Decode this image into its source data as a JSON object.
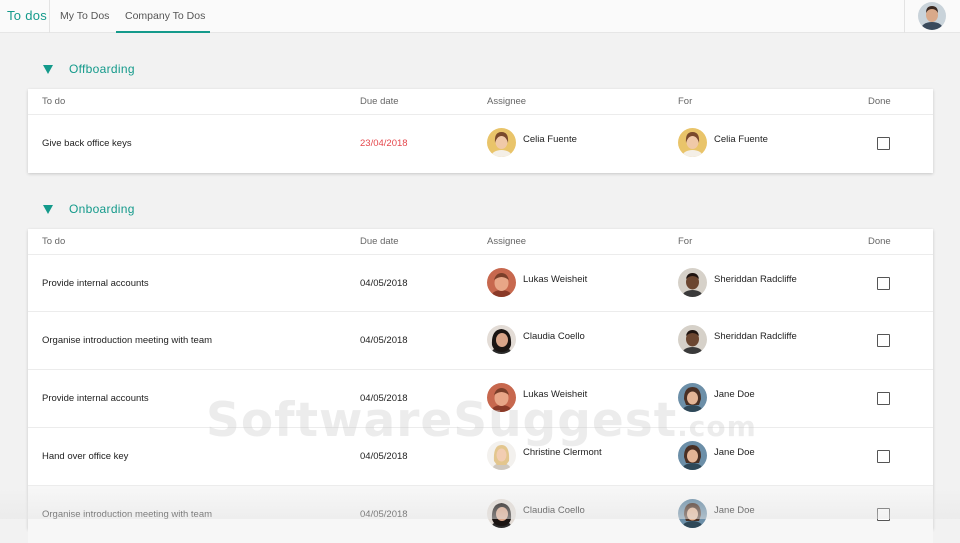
{
  "app": {
    "title": "To dos",
    "tabs": [
      {
        "label": "My To Dos",
        "active": false
      },
      {
        "label": "Company To Dos",
        "active": true
      }
    ],
    "accent_color": "#149a8b"
  },
  "columns": {
    "todo": "To do",
    "due": "Due date",
    "assignee": "Assignee",
    "for": "For",
    "done": "Done"
  },
  "sections": [
    {
      "title": "Offboarding",
      "rows": [
        {
          "todo": "Give back office keys",
          "due": "23/04/2018",
          "overdue": true,
          "assignee": "Celia Fuente",
          "for": "Celia Fuente",
          "done": false
        }
      ]
    },
    {
      "title": "Onboarding",
      "rows": [
        {
          "todo": "Provide internal accounts",
          "due": "04/05/2018",
          "overdue": false,
          "assignee": "Lukas Weisheit",
          "for": "Sheriddan Radcliffe",
          "done": false
        },
        {
          "todo": "Organise introduction meeting with team",
          "due": "04/05/2018",
          "overdue": false,
          "assignee": "Claudia Coello",
          "for": "Sheriddan Radcliffe",
          "done": false
        },
        {
          "todo": "Provide internal accounts",
          "due": "04/05/2018",
          "overdue": false,
          "assignee": "Lukas Weisheit",
          "for": "Jane Doe",
          "done": false
        },
        {
          "todo": "Hand over office key",
          "due": "04/05/2018",
          "overdue": false,
          "assignee": "Christine Clermont",
          "for": "Jane Doe",
          "done": false
        },
        {
          "todo": "Organise introduction meeting with team",
          "due": "04/05/2018",
          "overdue": false,
          "assignee": "Claudia Coello",
          "for": "Jane Doe",
          "done": false
        }
      ]
    }
  ],
  "watermark": {
    "main": "SoftwareSuggest",
    "suffix": ".com"
  },
  "overdue_color": "#e5484d"
}
